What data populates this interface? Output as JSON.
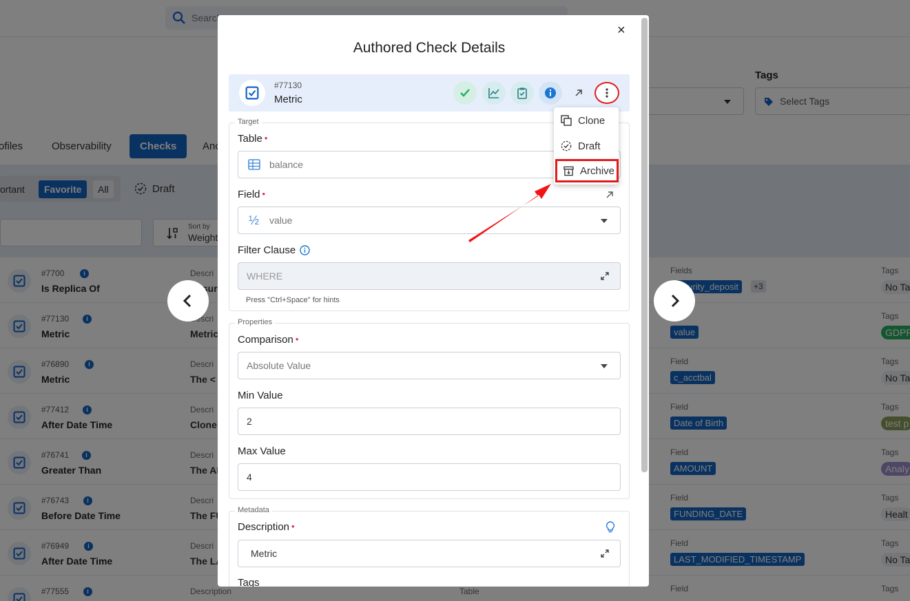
{
  "background": {
    "search_placeholder": "Search",
    "tags_label": "Tags",
    "tags_placeholder": "Select Tags",
    "tabs": [
      "ofiles",
      "Observability",
      "Checks",
      "Anc"
    ],
    "filters": {
      "important": "ortant",
      "favorite": "Favorite",
      "all": "All",
      "draft": "Draft"
    },
    "sort": {
      "label": "Sort by",
      "value": "Weight"
    },
    "rows": [
      {
        "id": "#7700",
        "name": "Is Replica Of",
        "desc_label": "Descri",
        "desc": "Ensuri",
        "field_label": "Fields",
        "field": "security_deposit",
        "extra": "+3",
        "tag_label": "Tags",
        "tag": "No Ta"
      },
      {
        "id": "#77130",
        "name": "Metric",
        "desc_label": "Descri",
        "desc": "Metric",
        "field_label": "",
        "field": "value",
        "extra": "",
        "tag_label": "Tags",
        "tag": "GDPR"
      },
      {
        "id": "#76890",
        "name": "Metric",
        "desc_label": "Descri",
        "desc": "The < f",
        "field_label": "Field",
        "field": "c_acctbal",
        "extra": "",
        "tag_label": "Tags",
        "tag": "No Ta"
      },
      {
        "id": "#77412",
        "name": "After Date Time",
        "desc_label": "Descri",
        "desc": "Clone",
        "field_label": "Field",
        "field": "Date of Birth",
        "extra": "",
        "tag_label": "Tags",
        "tag": "test p"
      },
      {
        "id": "#76741",
        "name": "Greater Than",
        "desc_label": "Descri",
        "desc": "The AM",
        "field_label": "Field",
        "field": "AMOUNT",
        "extra": "",
        "tag_label": "Tags",
        "tag": "Analy"
      },
      {
        "id": "#76743",
        "name": "Before Date Time",
        "desc_label": "Descri",
        "desc": "The FU",
        "field_label": "Field",
        "field": "FUNDING_DATE",
        "extra": "",
        "tag_label": "Tags",
        "tag": "Healt"
      },
      {
        "id": "#76949",
        "name": "After Date Time",
        "desc_label": "Descri",
        "desc": "The LA",
        "field_label": "Field",
        "field": "LAST_MODIFIED_TIMESTAMP",
        "extra": "",
        "tag_label": "Tags",
        "tag": "No Ta"
      },
      {
        "id": "#77555",
        "name": "",
        "desc_label": "Description",
        "desc": "",
        "field_label": "Field",
        "field": "",
        "extra": "",
        "tag_label": "Tags",
        "tag": "",
        "table_label": "Table"
      }
    ]
  },
  "modal": {
    "title": "Authored Check Details",
    "close": "×",
    "check_id": "#77130",
    "check_name": "Metric",
    "menu": {
      "clone": "Clone",
      "draft": "Draft",
      "archive": "Archive"
    },
    "target": {
      "legend": "Target",
      "table_label": "Table",
      "table_value": "balance",
      "field_label": "Field",
      "field_value": "value",
      "field_icon_text": "½",
      "filter_label": "Filter Clause",
      "filter_placeholder": "WHERE",
      "hint": "Press \"Ctrl+Space\" for hints"
    },
    "properties": {
      "legend": "Properties",
      "comparison_label": "Comparison",
      "comparison_value": "Absolute Value",
      "min_label": "Min Value",
      "min_value": "2",
      "max_label": "Max Value",
      "max_value": "4"
    },
    "metadata": {
      "legend": "Metadata",
      "description_label": "Description",
      "description_value": "Metric",
      "tags_label": "Tags"
    }
  },
  "colors": {
    "primary": "#1565c0",
    "highlight": "#e01b1b",
    "required": "#e0245e"
  }
}
